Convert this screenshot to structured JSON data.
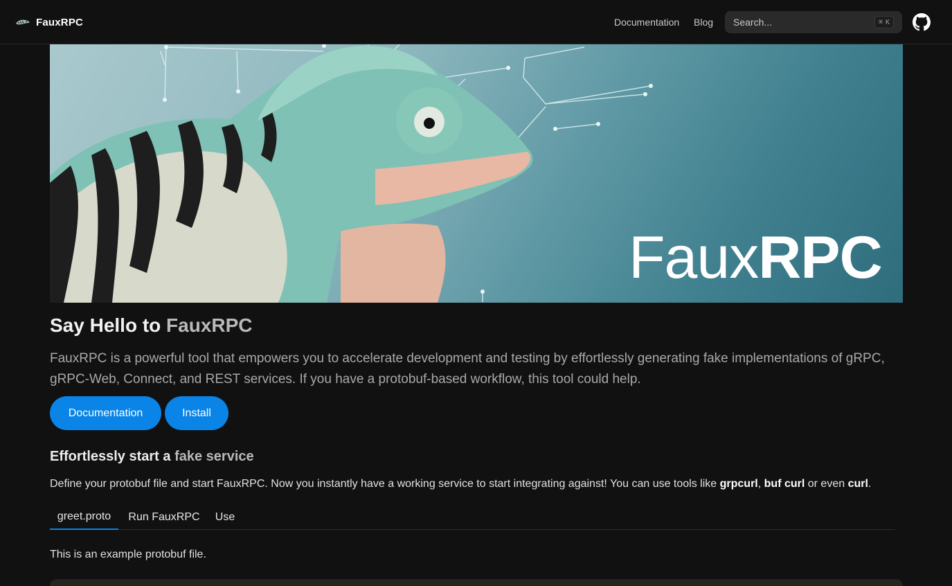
{
  "nav": {
    "brand": "FauxRPC",
    "links": [
      "Documentation",
      "Blog"
    ],
    "search_placeholder": "Search...",
    "search_shortcut_symbol": "⌘",
    "search_shortcut_key": "K",
    "github_icon": "github-icon"
  },
  "hero": {
    "word_thin": "Faux",
    "word_bold": "RPC"
  },
  "main": {
    "title_prefix": "Say Hello to ",
    "title_accent": "FauxRPC",
    "lead": "FauxRPC is a powerful tool that empowers you to accelerate development and testing by effortlessly generating fake implementations of gRPC, gRPC-Web, Connect, and REST services. If you have a protobuf-based workflow, this tool could help.",
    "buttons": [
      "Documentation",
      "Install"
    ],
    "section_title_prefix": "Effortlessly start a ",
    "section_title_accent": "fake service",
    "section_text": "Define your protobuf file and start FauxRPC. Now you instantly have a working service to start integrating against! You can use tools like ",
    "tool_1": "grpcurl",
    "sep_1": ", ",
    "tool_2": "buf curl",
    "sep_2": " or even ",
    "tool_3": "curl",
    "end": ".",
    "tabs": [
      "greet.proto",
      "Run FauxRPC",
      "Use"
    ],
    "active_tab": "greet.proto",
    "tab_note": "This is an example protobuf file."
  },
  "colors": {
    "background": "#111111",
    "accent_button": "#0a84e6",
    "muted_text": "#a9a9ad"
  }
}
